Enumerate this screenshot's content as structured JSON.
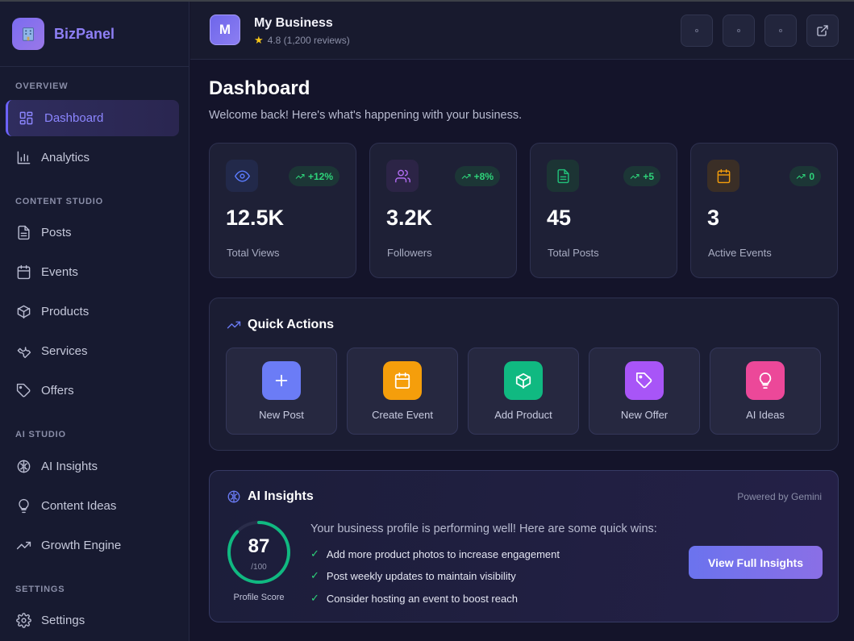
{
  "brand": {
    "name": "BizPanel",
    "logo_icon": "building-icon"
  },
  "sidebar": {
    "sections": [
      {
        "title": "OVERVIEW"
      },
      {
        "title": "CONTENT STUDIO"
      },
      {
        "title": "AI STUDIO"
      },
      {
        "title": "SETTINGS"
      }
    ],
    "items": [
      {
        "label": "Dashboard",
        "icon": "grid-icon",
        "active": true
      },
      {
        "label": "Analytics",
        "icon": "bar-chart-icon"
      },
      {
        "label": "Posts",
        "icon": "document-icon"
      },
      {
        "label": "Events",
        "icon": "calendar-icon"
      },
      {
        "label": "Products",
        "icon": "box-icon"
      },
      {
        "label": "Services",
        "icon": "wrench-icon"
      },
      {
        "label": "Offers",
        "icon": "tag-icon"
      },
      {
        "label": "AI Insights",
        "icon": "brain-icon"
      },
      {
        "label": "Content Ideas",
        "icon": "lightbulb-icon"
      },
      {
        "label": "Growth Engine",
        "icon": "trending-up-icon"
      },
      {
        "label": "Settings",
        "icon": "gear-icon"
      }
    ]
  },
  "header": {
    "avatar_letter": "M",
    "business_name": "My Business",
    "rating": "4.8 (1,200 reviews)",
    "buttons": [
      "dot-icon",
      "dot-icon",
      "dot-icon",
      "external-link-icon"
    ]
  },
  "main": {
    "title": "Dashboard",
    "subtitle": "Welcome back! Here's what's happening with your business."
  },
  "stats": [
    {
      "value": "12.5K",
      "label": "Total Views",
      "trend": "+12%",
      "icon": "eye-icon",
      "color": "#5b7cff"
    },
    {
      "value": "3.2K",
      "label": "Followers",
      "trend": "+8%",
      "icon": "users-icon",
      "color": "#b06cf0"
    },
    {
      "value": "45",
      "label": "Total Posts",
      "trend": "+5",
      "icon": "file-text-icon",
      "color": "#22c17a"
    },
    {
      "value": "3",
      "label": "Active Events",
      "trend": "0",
      "icon": "calendar-icon",
      "color": "#f59e0b"
    }
  ],
  "quick_actions": {
    "title": "Quick Actions",
    "items": [
      {
        "label": "New Post",
        "icon": "plus-icon",
        "color": "#6b7cf6"
      },
      {
        "label": "Create Event",
        "icon": "calendar-icon",
        "color": "#f59e0b"
      },
      {
        "label": "Add Product",
        "icon": "box-icon",
        "color": "#10b981"
      },
      {
        "label": "New Offer",
        "icon": "tag-icon",
        "color": "#a855f7"
      },
      {
        "label": "AI Ideas",
        "icon": "lightbulb-icon",
        "color": "#ec4899"
      }
    ]
  },
  "ai_insights": {
    "title": "AI Insights",
    "powered_by": "Powered by Gemini",
    "score": "87",
    "score_max": "/100",
    "score_fraction": 0.87,
    "score_label": "Profile Score",
    "headline": "Your business profile is performing well! Here are some quick wins:",
    "tips": [
      "Add more product photos to increase engagement",
      "Post weekly updates to maintain visibility",
      "Consider hosting an event to boost reach"
    ],
    "button": "View Full Insights",
    "ring_color": "#10b981"
  }
}
